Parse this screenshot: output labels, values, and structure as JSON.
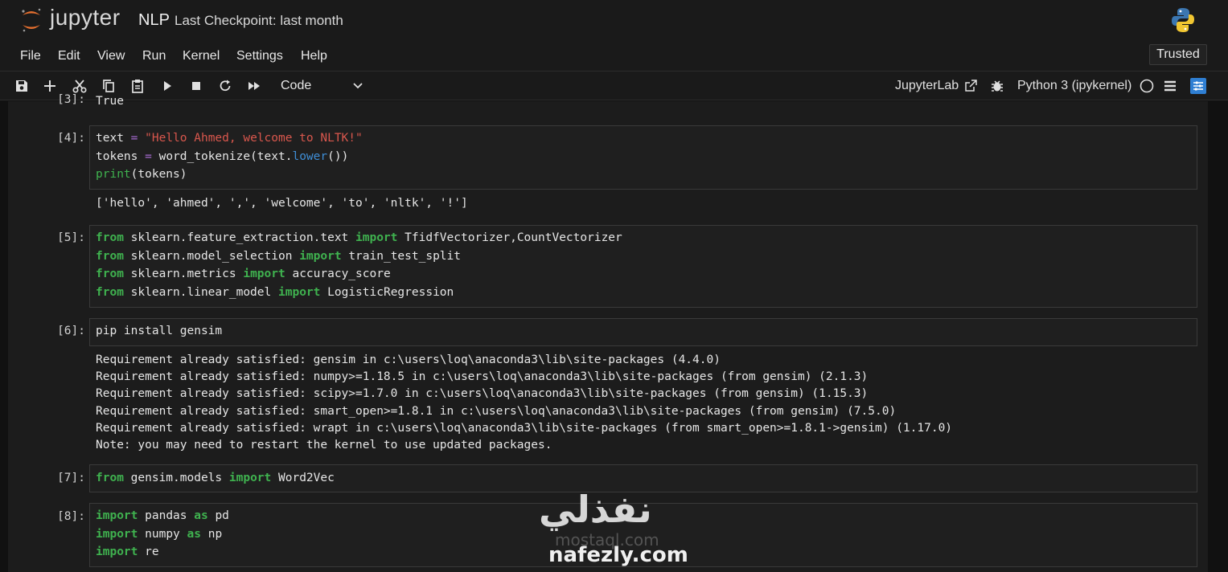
{
  "header": {
    "logo_text": "jupyter",
    "notebook_name": "NLP",
    "checkpoint": "Last Checkpoint: last month"
  },
  "menu": [
    "File",
    "Edit",
    "View",
    "Run",
    "Kernel",
    "Settings",
    "Help"
  ],
  "trusted_label": "Trusted",
  "toolbar": {
    "cell_type": "Code",
    "jupyterlab_label": "JupyterLab",
    "kernel_name": "Python 3 (ipykernel)"
  },
  "cells": {
    "c3": {
      "prompt": "[3]:",
      "output": "True"
    },
    "c4": {
      "prompt": "[4]:",
      "output": "['hello', 'ahmed', ',', 'welcome', 'to', 'nltk', '!']"
    },
    "c5": {
      "prompt": "[5]:"
    },
    "c6": {
      "prompt": "[6]:",
      "output": [
        "Requirement already satisfied: gensim in c:\\users\\loq\\anaconda3\\lib\\site-packages (4.4.0)",
        "Requirement already satisfied: numpy>=1.18.5 in c:\\users\\loq\\anaconda3\\lib\\site-packages (from gensim) (2.1.3)",
        "Requirement already satisfied: scipy>=1.7.0 in c:\\users\\loq\\anaconda3\\lib\\site-packages (from gensim) (1.15.3)",
        "Requirement already satisfied: smart_open>=1.8.1 in c:\\users\\loq\\anaconda3\\lib\\site-packages (from gensim) (7.5.0)",
        "Requirement already satisfied: wrapt in c:\\users\\loq\\anaconda3\\lib\\site-packages (from smart_open>=1.8.1->gensim) (1.17.0)",
        "Note: you may need to restart the kernel to use updated packages."
      ]
    },
    "c7": {
      "prompt": "[7]:"
    },
    "c8": {
      "prompt": "[8]:"
    }
  },
  "code_tokens": {
    "text": "text",
    "eq": "=",
    "hello_str": "\"Hello Ahmed, welcome to NLTK!\"",
    "tokens": "tokens",
    "word_tokenize": "word_tokenize(text.",
    "lower": "lower",
    "parens": "())",
    "print": "print",
    "print_args": "(tokens)",
    "from": "from",
    "import": "import",
    "as": "as",
    "m1": "sklearn.feature_extraction.text",
    "n1": "TfidfVectorizer,CountVectorizer",
    "m2": "sklearn.model_selection",
    "n2": "train_test_split",
    "m3": "sklearn.metrics",
    "n3": "accuracy_score",
    "m4": "sklearn.linear_model",
    "n4": "LogisticRegression",
    "pip": "pip install gensim",
    "m5": "gensim.models",
    "n5": "Word2Vec",
    "pandas": "pandas",
    "pd": "pd",
    "numpy": "numpy",
    "np": "np",
    "re": "re"
  },
  "watermark": {
    "arabic": "نفذلي",
    "latin": "nafezly.com",
    "shadow": "mostaql.com"
  },
  "colors": {
    "keyword": "#3fb24f",
    "operator": "#a66bd1",
    "string": "#d9574d",
    "function": "#3f8ed6",
    "accent": "#2f7fd3"
  }
}
